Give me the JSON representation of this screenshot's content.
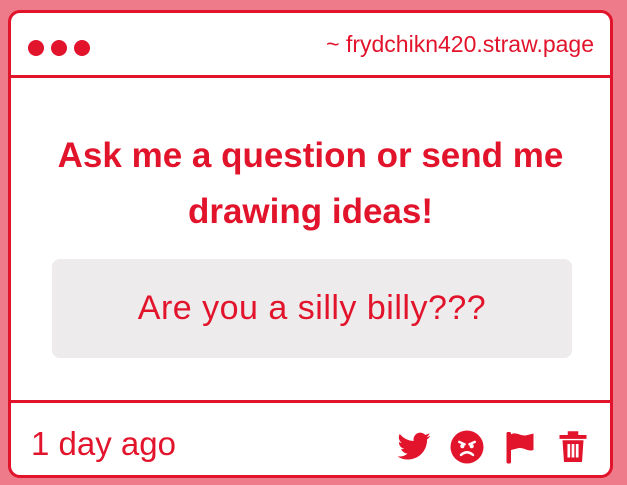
{
  "window": {
    "url": "~ frydchikn420.straw.page"
  },
  "main": {
    "prompt": "Ask me a question or send me drawing ideas!",
    "question": "Are you a silly billy???"
  },
  "footer": {
    "timestamp": "1 day ago",
    "actions": [
      {
        "icon": "twitter-icon"
      },
      {
        "icon": "angry-face-icon"
      },
      {
        "icon": "flag-icon"
      },
      {
        "icon": "trash-icon"
      }
    ]
  },
  "colors": {
    "accent": "#e2142c",
    "background": "#ee7b8a",
    "question_box": "#edebec",
    "card": "#ffffff"
  }
}
